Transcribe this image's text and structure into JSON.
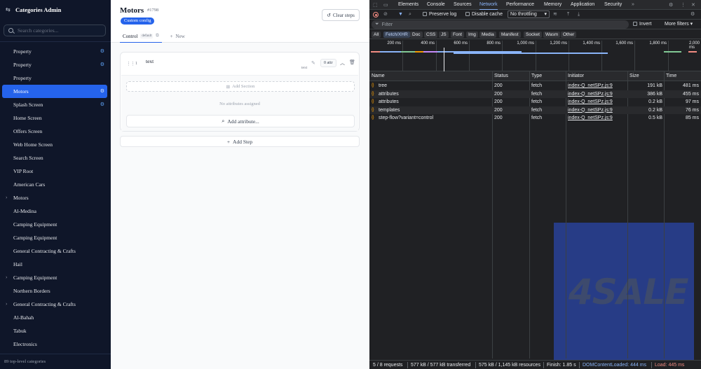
{
  "sidebar": {
    "title": "Categories Admin",
    "search_placeholder": "Search categories...",
    "items": [
      {
        "label": "Property",
        "chevron": false,
        "gear": true
      },
      {
        "label": "Property",
        "chevron": false,
        "gear": true
      },
      {
        "label": "Property",
        "chevron": false,
        "gear": false
      },
      {
        "label": "Motors",
        "chevron": false,
        "gear": true,
        "active": true
      },
      {
        "label": "Splash Screen",
        "chevron": false,
        "gear": true
      },
      {
        "label": "Home Screen",
        "chevron": false,
        "gear": false
      },
      {
        "label": "Offers Screen",
        "chevron": false,
        "gear": false
      },
      {
        "label": "Web Home Screen",
        "chevron": false,
        "gear": false
      },
      {
        "label": "Search Screen",
        "chevron": false,
        "gear": false
      },
      {
        "label": "VIP Root",
        "chevron": false,
        "gear": false
      },
      {
        "label": "American Cars",
        "chevron": false,
        "gear": false
      },
      {
        "label": "Motors",
        "chevron": true,
        "gear": false
      },
      {
        "label": "Al-Medina",
        "chevron": false,
        "gear": false
      },
      {
        "label": "Camping Equipment",
        "chevron": false,
        "gear": false
      },
      {
        "label": "Camping Equipment",
        "chevron": false,
        "gear": false
      },
      {
        "label": "General Contracting & Crafts",
        "chevron": false,
        "gear": false
      },
      {
        "label": "Hail",
        "chevron": false,
        "gear": false
      },
      {
        "label": "Camping Equipment",
        "chevron": true,
        "gear": false
      },
      {
        "label": "Northern Borders",
        "chevron": false,
        "gear": false
      },
      {
        "label": "General Contracting & Crafts",
        "chevron": true,
        "gear": false
      },
      {
        "label": "Al-Bahah",
        "chevron": false,
        "gear": false
      },
      {
        "label": "Tabuk",
        "chevron": false,
        "gear": false
      },
      {
        "label": "Electronics",
        "chevron": false,
        "gear": false
      }
    ],
    "footer": "89 top-level categories"
  },
  "editor": {
    "title": "Motors",
    "id": "#1798",
    "chip": "Custom config",
    "clear_label": "Clear steps",
    "tabs": [
      {
        "label": "Control",
        "badge": "default"
      },
      {
        "label": "New"
      }
    ],
    "step": {
      "number": "1",
      "name": "text",
      "subname": "text",
      "attr_count": "0 attr",
      "add_section": "Add Section",
      "no_attrs": "No attributes assigned",
      "add_attribute": "Add attribute..."
    },
    "add_step": "Add Step"
  },
  "devtools": {
    "tabs": [
      "Elements",
      "Console",
      "Sources",
      "Network",
      "Performance",
      "Memory",
      "Application",
      "Security"
    ],
    "active_tab": "Network",
    "preserve_log": "Preserve log",
    "disable_cache": "Disable cache",
    "throttling": "No throttling",
    "filter_placeholder": "Filter",
    "invert": "Invert",
    "more_filters": "More filters",
    "type_filters": [
      "All",
      "Fetch/XHR",
      "Doc",
      "CSS",
      "JS",
      "Font",
      "Img",
      "Media",
      "Manifest",
      "Socket",
      "Wasm",
      "Other"
    ],
    "active_filter": "Fetch/XHR",
    "timeline_ticks": [
      "200 ms",
      "400 ms",
      "600 ms",
      "800 ms",
      "1,000 ms",
      "1,200 ms",
      "1,400 ms",
      "1,600 ms",
      "1,800 ms",
      "2,000 ms"
    ],
    "columns": [
      "Name",
      "Status",
      "Type",
      "Initiator",
      "Size",
      "Time"
    ],
    "rows": [
      {
        "name": "tree",
        "status": "200",
        "type": "fetch",
        "initiator": "index-Q_netSPz.js:9",
        "size": "191 kB",
        "time": "481 ms"
      },
      {
        "name": "attributes",
        "status": "200",
        "type": "fetch",
        "initiator": "index-Q_netSPz.js:9",
        "size": "386 kB",
        "time": "455 ms"
      },
      {
        "name": "attributes",
        "status": "200",
        "type": "fetch",
        "initiator": "index-Q_netSPz.js:9",
        "size": "0.2 kB",
        "time": "97 ms"
      },
      {
        "name": "templates",
        "status": "200",
        "type": "fetch",
        "initiator": "index-Q_netSPz.js:9",
        "size": "0.2 kB",
        "time": "76 ms"
      },
      {
        "name": "step-flow?variant=control",
        "status": "200",
        "type": "fetch",
        "initiator": "index-Q_netSPz.js:9",
        "size": "0.5 kB",
        "time": "85 ms"
      }
    ],
    "watermark": "4SALE",
    "status_bar": {
      "requests": "5 / 8 requests",
      "transferred": "577 kB / 577 kB transferred",
      "resources": "575 kB / 1,145 kB resources",
      "finish": "Finish: 1.85 s",
      "dcl": "DOMContentLoaded: 444 ms",
      "load": "Load: 445 ms"
    }
  },
  "colors": {
    "sidebar_bg": "#0f1629",
    "accent": "#2563eb",
    "devtools_bg": "#202124",
    "devtools_link": "#8ab4f8",
    "dcl_color": "#8ab4f8",
    "load_color": "#f28b82"
  }
}
